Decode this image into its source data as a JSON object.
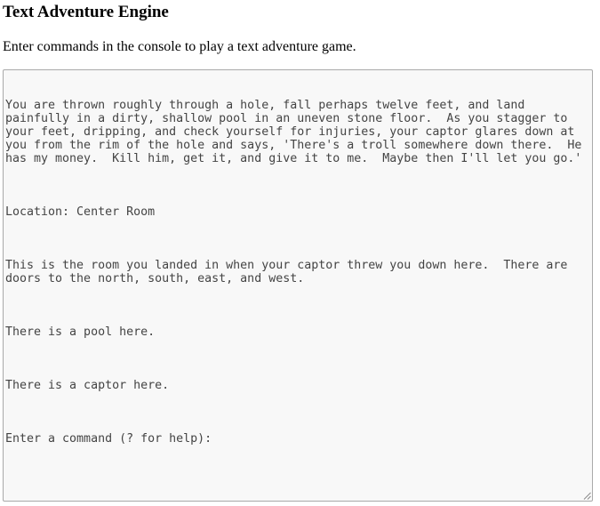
{
  "page": {
    "title": "Text Adventure Engine",
    "subtitle": "Enter commands in the console to play a text adventure game."
  },
  "console": {
    "paragraphs": [
      "You are thrown roughly through a hole, fall perhaps twelve feet, and land painfully in a dirty, shallow pool in an uneven stone floor.  As you stagger to your feet, dripping, and check yourself for injuries, your captor glares down at you from the rim of the hole and says, 'There's a troll somewhere down there.  He has my money.  Kill him, get it, and give it to me.  Maybe then I'll let you go.'",
      "Location: Center Room",
      "This is the room you landed in when your captor threw you down here.  There are doors to the north, south, east, and west.",
      "There is a pool here.",
      "There is a captor here.",
      "Enter a command (? for help):"
    ]
  },
  "icons": {
    "resize_grip": "resize-grip-icon"
  },
  "colors": {
    "console_background": "#f8f8f8",
    "console_border": "#a9a9a9",
    "console_text": "#444444"
  }
}
